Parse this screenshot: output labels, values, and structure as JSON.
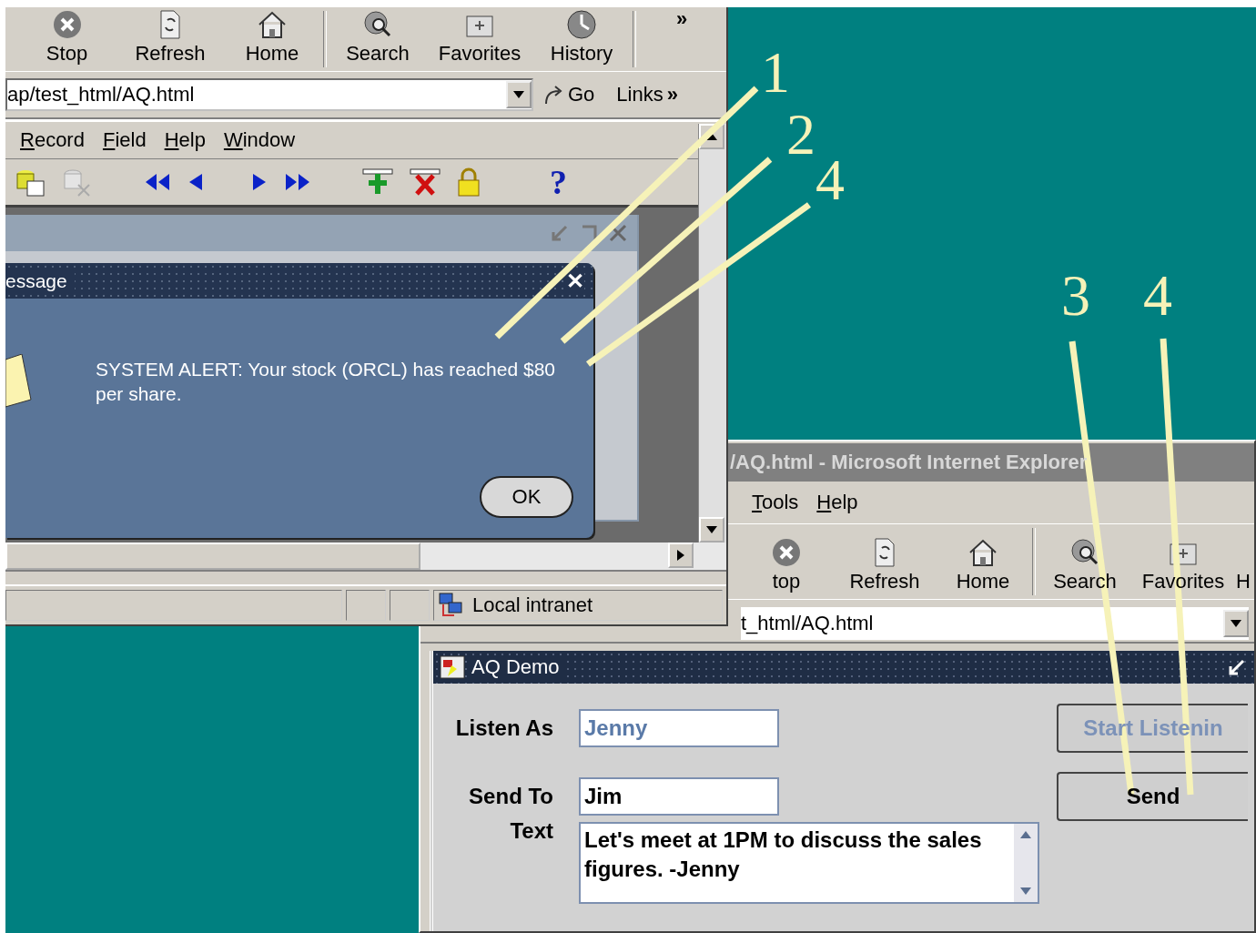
{
  "back_browser": {
    "toolbar": [
      {
        "label": "Stop"
      },
      {
        "label": "Refresh"
      },
      {
        "label": "Home"
      },
      {
        "label": "Search"
      },
      {
        "label": "Favorites"
      },
      {
        "label": "History"
      }
    ],
    "more": "»",
    "address": "ap/test_html/AQ.html",
    "go": "Go",
    "links": "Links",
    "links_more": "»"
  },
  "forms_app": {
    "menu": [
      "Record",
      "Field",
      "Help",
      "Window"
    ],
    "help_glyph": "?",
    "message_dialog": {
      "title": "essage",
      "close": "✕",
      "text": "SYSTEM ALERT: Your stock (ORCL) has reached $80 per share.",
      "ok": "OK"
    },
    "status": "Local intranet"
  },
  "front_browser": {
    "title": "/AQ.html - Microsoft Internet Explorer",
    "menu": [
      "Tools",
      "Help"
    ],
    "toolbar": [
      {
        "label": "top"
      },
      {
        "label": "Refresh"
      },
      {
        "label": "Home"
      },
      {
        "label": "Search"
      },
      {
        "label": "Favorites"
      },
      {
        "label": "H"
      }
    ],
    "address": "t_html/AQ.html"
  },
  "aq_demo": {
    "title": "AQ Demo",
    "listen_as": {
      "label": "Listen As",
      "value": "Jenny"
    },
    "start_button": "Start Listenin",
    "send_to": {
      "label": "Send To",
      "value": "Jim"
    },
    "send_button": "Send",
    "text": {
      "label": "Text",
      "value": "Let's meet at 1PM to discuss the sales figures. -Jenny"
    }
  },
  "annotations": [
    {
      "label": "1"
    },
    {
      "label": "2"
    },
    {
      "label": "4"
    },
    {
      "label": "3"
    },
    {
      "label": "4"
    }
  ]
}
